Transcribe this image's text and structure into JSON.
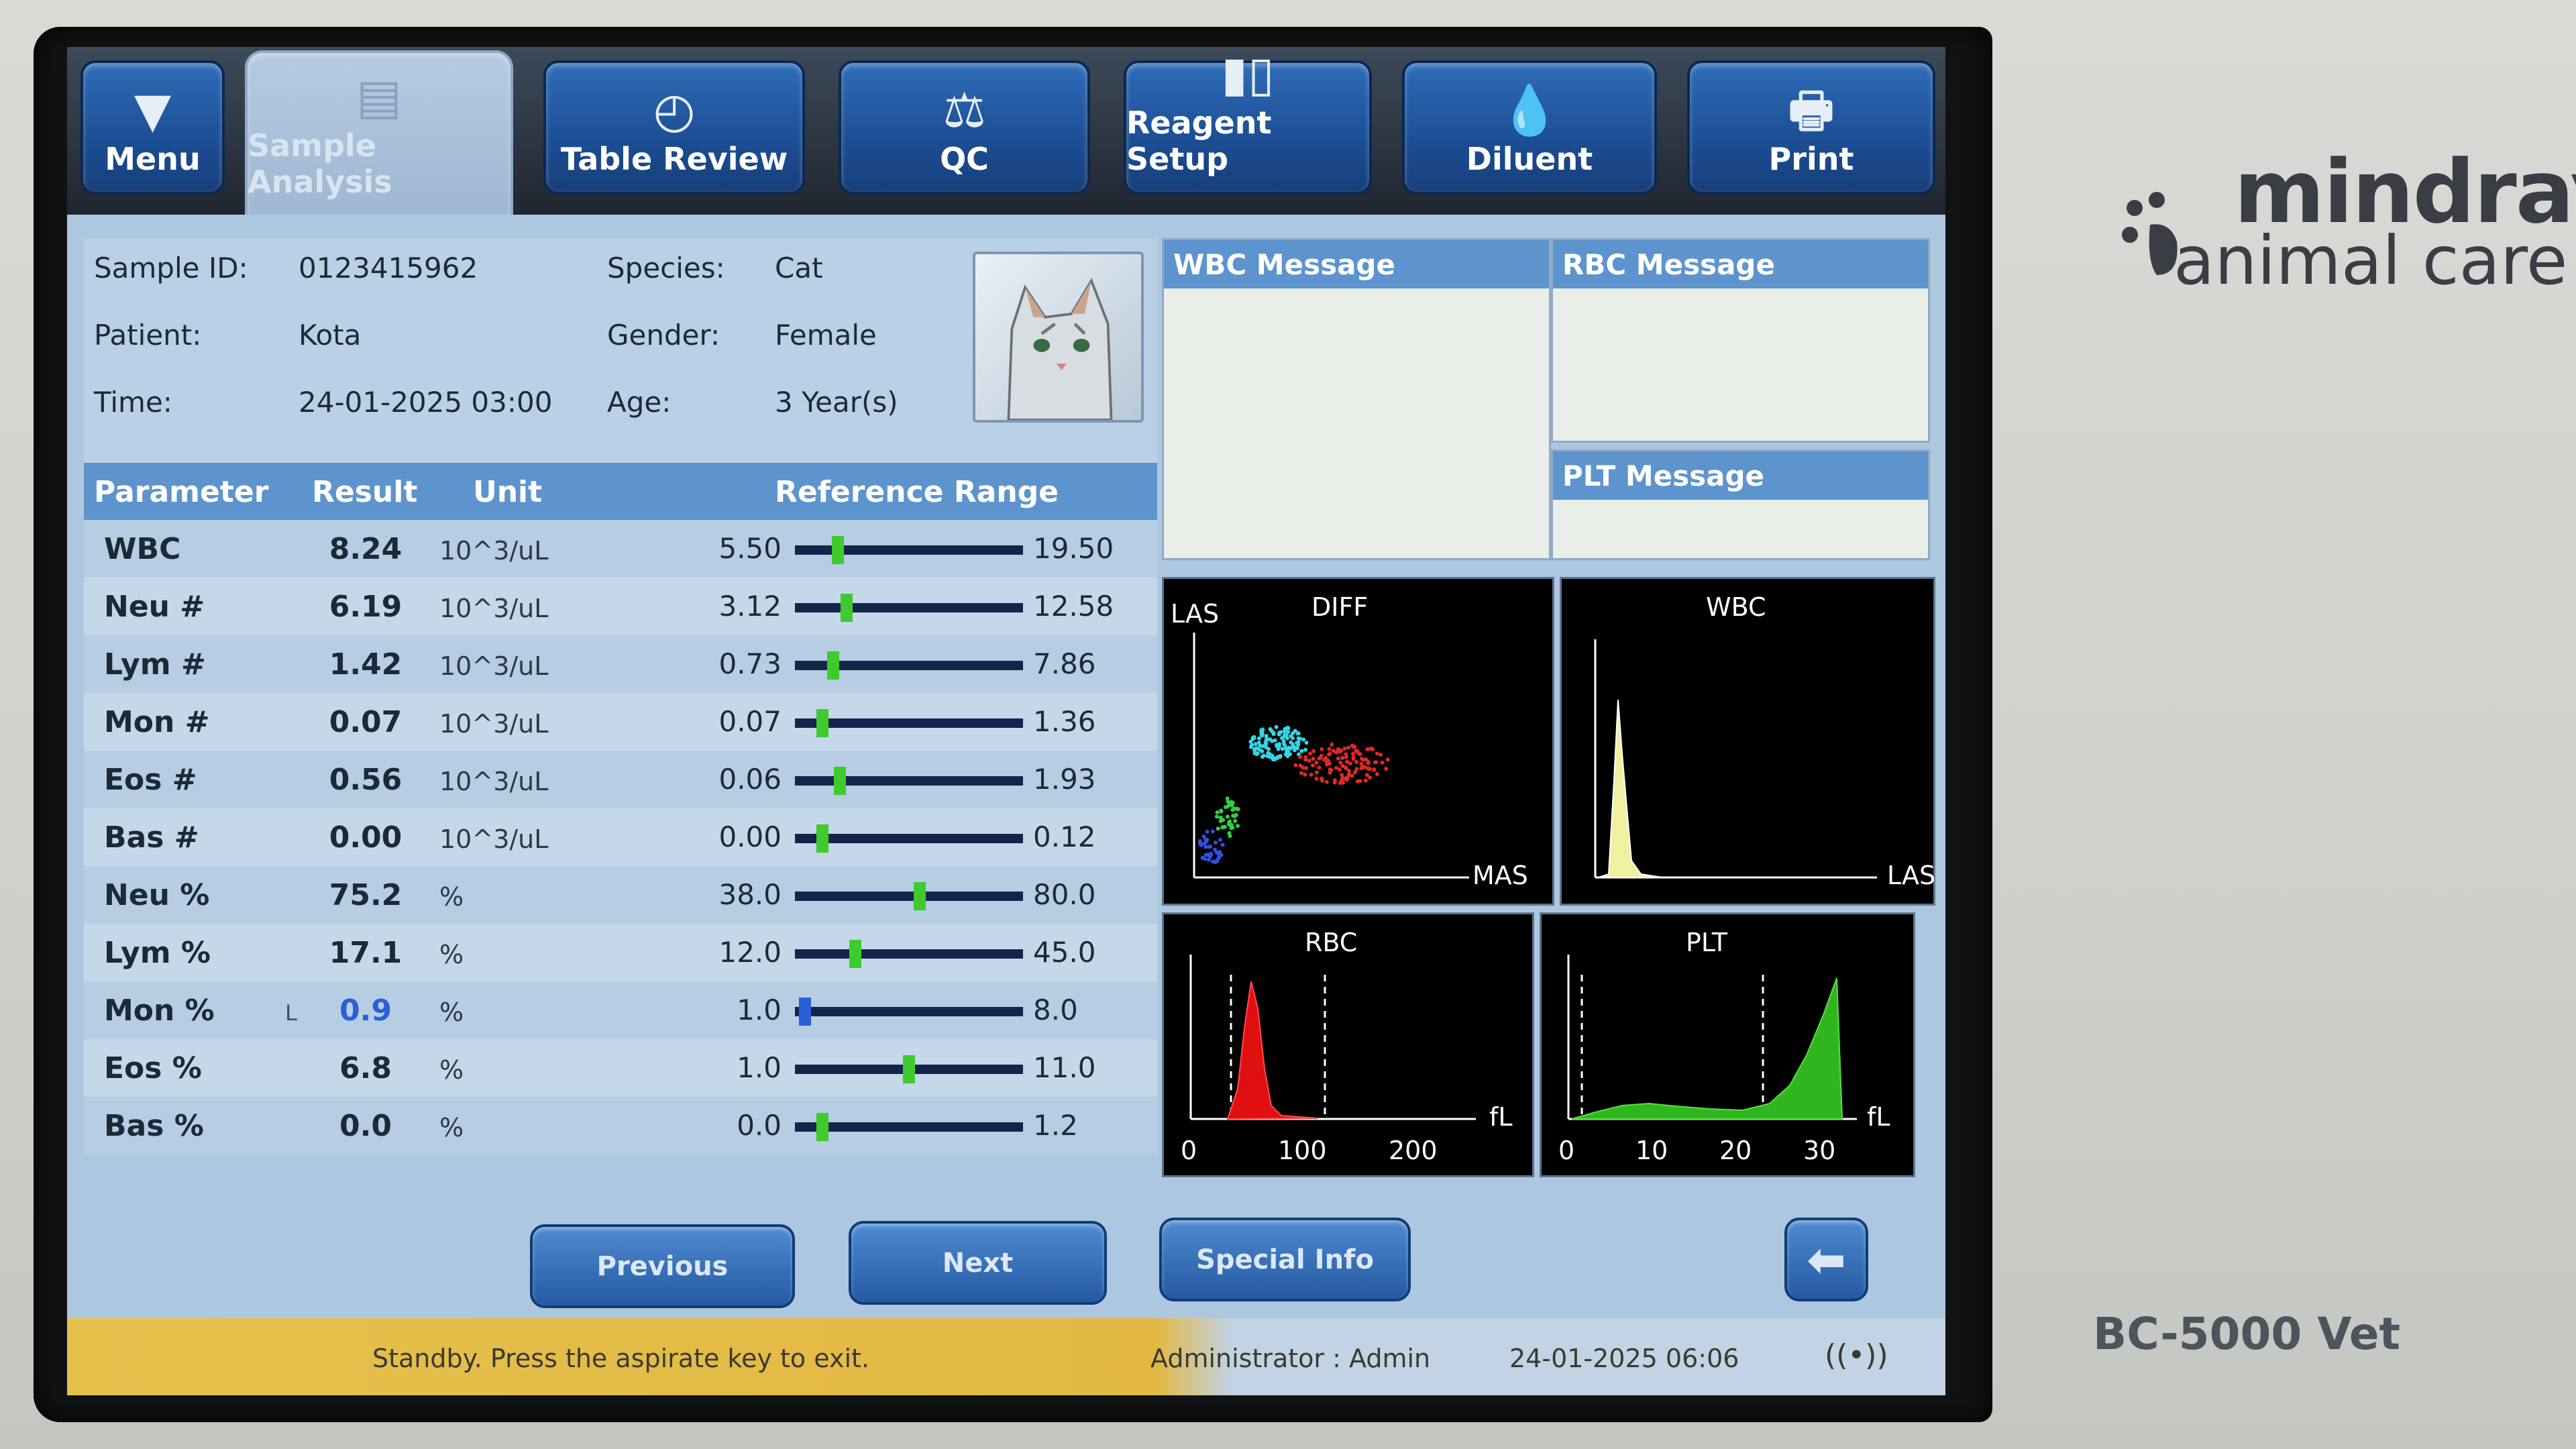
{
  "tabs": [
    {
      "label": "Menu",
      "icon": "triangle-down-icon"
    },
    {
      "label": "Sample Analysis",
      "icon": "chart-doc-icon"
    },
    {
      "label": "Table Review",
      "icon": "refresh-icon"
    },
    {
      "label": "QC",
      "icon": "balance-icon"
    },
    {
      "label": "Reagent Setup",
      "icon": "bottles-icon"
    },
    {
      "label": "Diluent",
      "icon": "drop-plus-icon"
    },
    {
      "label": "Print",
      "icon": "printer-icon"
    }
  ],
  "info": {
    "sample_id_label": "Sample ID:",
    "sample_id": "0123415962",
    "patient_label": "Patient:",
    "patient": "Kota",
    "time_label": "Time:",
    "time": "24-01-2025 03:00",
    "species_label": "Species:",
    "species": "Cat",
    "gender_label": "Gender:",
    "gender": "Female",
    "age_label": "Age:",
    "age": "3 Year(s)"
  },
  "table": {
    "headers": {
      "parameter": "Parameter",
      "result": "Result",
      "unit": "Unit",
      "range": "Reference Range"
    },
    "rows": [
      {
        "param": "WBC",
        "result": "8.24",
        "flag": "",
        "unit": "10^3/uL",
        "low": "5.50",
        "high": "19.50",
        "pos": 0.17
      },
      {
        "param": "Neu #",
        "result": "6.19",
        "flag": "",
        "unit": "10^3/uL",
        "low": "3.12",
        "high": "12.58",
        "pos": 0.21
      },
      {
        "param": "Lym #",
        "result": "1.42",
        "flag": "",
        "unit": "10^3/uL",
        "low": "0.73",
        "high": "7.86",
        "pos": 0.15
      },
      {
        "param": "Mon #",
        "result": "0.07",
        "flag": "",
        "unit": "10^3/uL",
        "low": "0.07",
        "high": "1.36",
        "pos": 0.1
      },
      {
        "param": "Eos #",
        "result": "0.56",
        "flag": "",
        "unit": "10^3/uL",
        "low": "0.06",
        "high": "1.93",
        "pos": 0.18
      },
      {
        "param": "Bas #",
        "result": "0.00",
        "flag": "",
        "unit": "10^3/uL",
        "low": "0.00",
        "high": "0.12",
        "pos": 0.1
      },
      {
        "param": "Neu %",
        "result": "75.2",
        "flag": "",
        "unit": "%",
        "low": "38.0",
        "high": "80.0",
        "pos": 0.55
      },
      {
        "param": "Lym %",
        "result": "17.1",
        "flag": "",
        "unit": "%",
        "low": "12.0",
        "high": "45.0",
        "pos": 0.25
      },
      {
        "param": "Mon %",
        "result": "0.9",
        "flag": "L",
        "unit": "%",
        "low": "1.0",
        "high": "8.0",
        "pos": 0.02
      },
      {
        "param": "Eos %",
        "result": "6.8",
        "flag": "",
        "unit": "%",
        "low": "1.0",
        "high": "11.0",
        "pos": 0.5
      },
      {
        "param": "Bas %",
        "result": "0.0",
        "flag": "",
        "unit": "%",
        "low": "0.0",
        "high": "1.2",
        "pos": 0.1
      }
    ]
  },
  "messages": {
    "wbc": "WBC Message",
    "rbc": "RBC Message",
    "plt": "PLT Message"
  },
  "plots": {
    "diff": {
      "title": "DIFF",
      "y_axis": "LAS",
      "x_axis": "MAS"
    },
    "wbc": {
      "title": "WBC",
      "x_axis": "LAS"
    },
    "rbc": {
      "title": "RBC",
      "unit": "fL",
      "ticks": [
        "0",
        "100",
        "200"
      ]
    },
    "plt": {
      "title": "PLT",
      "unit": "fL",
      "ticks": [
        "0",
        "10",
        "20",
        "30"
      ]
    }
  },
  "buttons": {
    "previous": "Previous",
    "next": "Next",
    "special_info": "Special Info"
  },
  "status": {
    "message": "Standby. Press the aspirate key to exit.",
    "user": "Administrator : Admin",
    "datetime": "24-01-2025 06:06"
  },
  "brand": {
    "line1": "mindray",
    "line2": "animal care",
    "model": "BC-5000 Vet"
  },
  "colors": {
    "accent": "#5d94cd",
    "button": "#245aa3",
    "status_yellow": "#e5c14c",
    "in_range": "#3fca2e",
    "low": "#2a5fd6"
  }
}
